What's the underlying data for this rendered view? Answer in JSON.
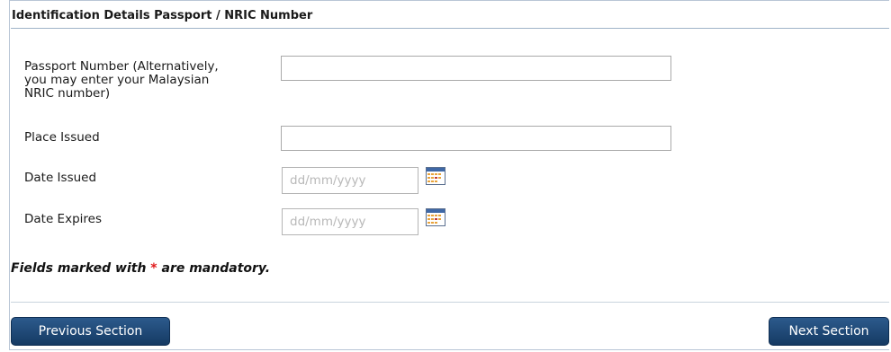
{
  "section": {
    "title": "Identification Details Passport / NRIC Number"
  },
  "fields": {
    "passport": {
      "label_lines": [
        "Passport Number (Alternatively,",
        "you may enter your Malaysian",
        "NRIC number)"
      ],
      "value": ""
    },
    "place_issued": {
      "label": "Place Issued",
      "value": ""
    },
    "date_issued": {
      "label": "Date Issued",
      "placeholder": "dd/mm/yyyy"
    },
    "date_expires": {
      "label": "Date Expires",
      "placeholder": "dd/mm/yyyy"
    }
  },
  "note": {
    "before": "Fields marked with",
    "star": "*",
    "after": "are mandatory."
  },
  "buttons": {
    "previous": "Previous Section",
    "next": "Next Section"
  },
  "icons": {
    "date_picker": "calendar-icon"
  },
  "colors": {
    "button": "#1f4a78",
    "required_star": "#e0191a"
  }
}
